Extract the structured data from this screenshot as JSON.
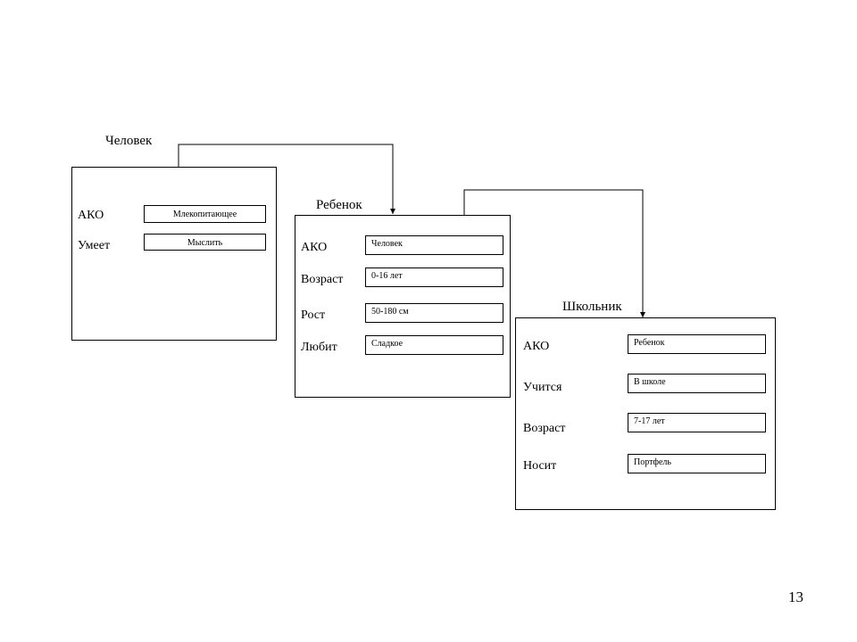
{
  "page_number": "13",
  "frames": {
    "human": {
      "title": "Человек",
      "attrs": [
        {
          "label": "АКО",
          "value": "Млекопитающее"
        },
        {
          "label": "Умеет",
          "value": "Мыслить"
        }
      ]
    },
    "child": {
      "title": "Ребенок",
      "attrs": [
        {
          "label": "АКО",
          "value": "Человек"
        },
        {
          "label": "Возраст",
          "value": "0-16 лет"
        },
        {
          "label": "Рост",
          "value": "50-180 см"
        },
        {
          "label": "Любит",
          "value": "Сладкое"
        }
      ]
    },
    "student": {
      "title": "Школьник",
      "attrs": [
        {
          "label": "АКО",
          "value": "Ребенок"
        },
        {
          "label": "Учится",
          "value": "В школе"
        },
        {
          "label": "Возраст",
          "value": "7-17 лет"
        },
        {
          "label": "Носит",
          "value": "Портфель"
        }
      ]
    }
  }
}
